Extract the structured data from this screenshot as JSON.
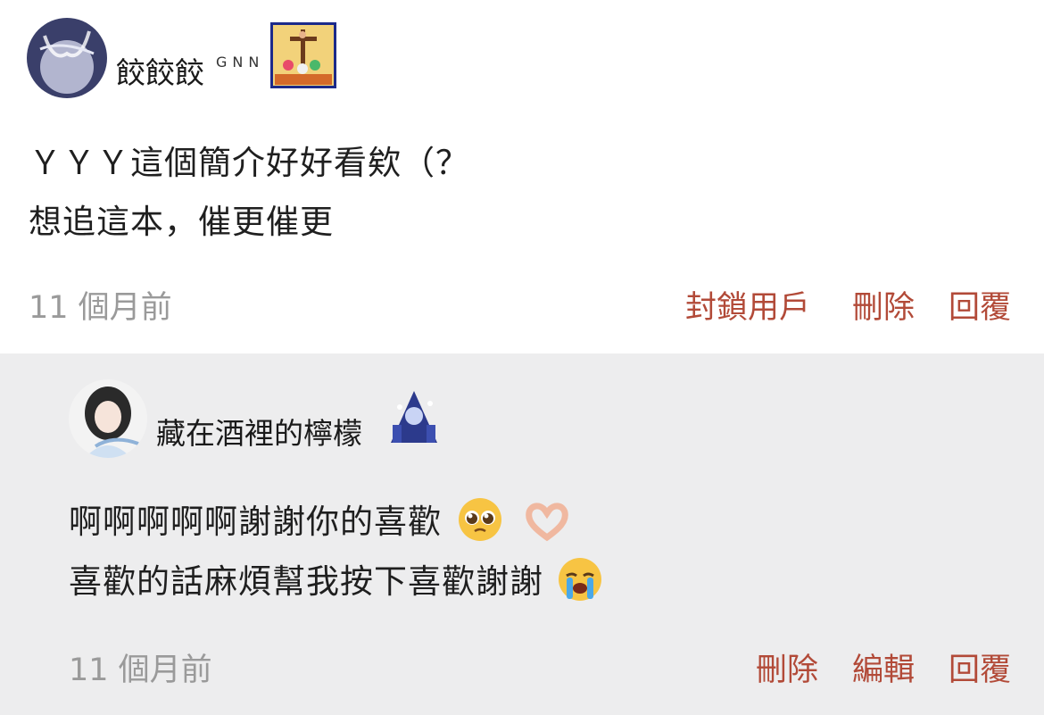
{
  "main_comment": {
    "username": "餃餃餃",
    "gnn_tag": "GNN",
    "lines": [
      "ＹＹＹ這個簡介好好看欸（？",
      "想追這本，催更催更"
    ],
    "time": "11 個月前",
    "actions": {
      "block": "封鎖用戶",
      "delete": "刪除",
      "reply": "回覆"
    }
  },
  "reply_comment": {
    "username": "藏在酒裡的檸檬",
    "lines": [
      "啊啊啊啊啊謝謝你的喜歡",
      "喜歡的話麻煩幫我按下喜歡謝謝"
    ],
    "emojis": [
      "pleading-face-icon",
      "heart-hands-icon",
      "loudly-crying-face-icon"
    ],
    "time": "11 個月前",
    "actions": {
      "delete": "刪除",
      "edit": "編輯",
      "reply": "回覆"
    }
  },
  "colors": {
    "action": "#b24a38",
    "time": "#9a9a9a",
    "reply_bg": "#ededee"
  }
}
